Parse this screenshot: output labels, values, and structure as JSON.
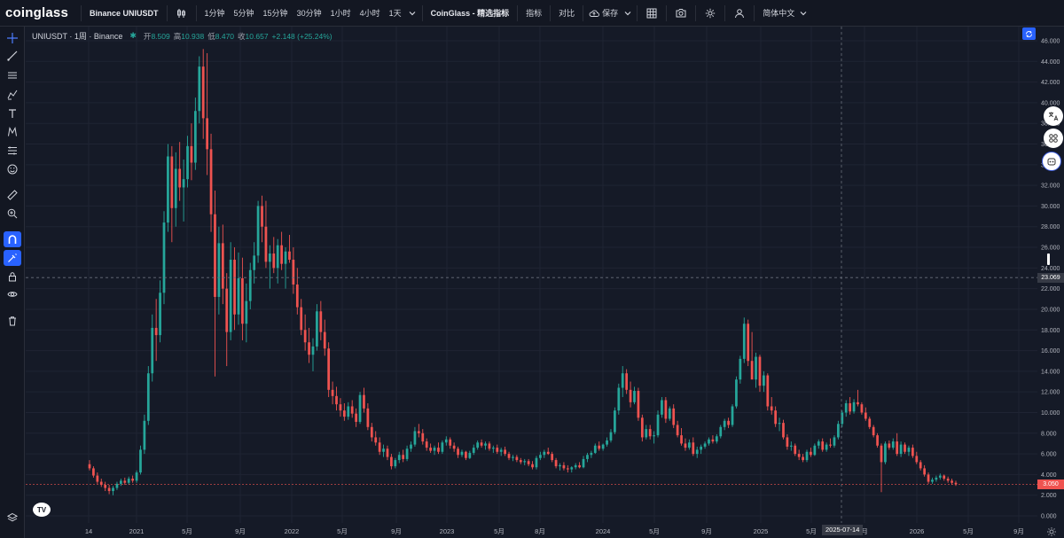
{
  "app": {
    "logo": "coinglass",
    "pair_title": "Binance UNIUSDT"
  },
  "toolbar": {
    "intervals": [
      "1分钟",
      "5分钟",
      "15分钟",
      "30分钟",
      "1小时",
      "4小时",
      "1天"
    ],
    "coinglass_label": "CoinGlass - 精选指标",
    "indicator_label": "指标",
    "compare_label": "对比",
    "save_label": "保存",
    "language_label": "简体中文"
  },
  "legend": {
    "symbol": "UNIUSDT · 1周 · Binance",
    "open_label": "开",
    "open": "8.509",
    "high_label": "高",
    "high": "10.938",
    "low_label": "低",
    "low": "8.470",
    "close_label": "收",
    "close": "10.657",
    "change": "+2.148 (+25.24%)"
  },
  "price_axis": {
    "ticks": [
      "46.000",
      "44.000",
      "42.000",
      "40.000",
      "38.000",
      "36.000",
      "34.000",
      "32.000",
      "30.000",
      "28.000",
      "26.000",
      "24.000",
      "22.000",
      "20.000",
      "18.000",
      "16.000",
      "14.000",
      "12.000",
      "10.000",
      "8.000",
      "6.000",
      "4.000",
      "2.000",
      "0.000"
    ],
    "crosshair_price": "23.069",
    "last_price": "3.050"
  },
  "time_axis": {
    "ticks": [
      "14",
      "2021",
      "5月",
      "9月",
      "2022",
      "5月",
      "9月",
      "2023",
      "5月",
      "8月",
      "2024",
      "5月",
      "9月",
      "2025",
      "5月",
      "月",
      "2026",
      "5月",
      "9月"
    ],
    "crosshair_date": "2025-07-14"
  },
  "colors": {
    "up": "#26a69a",
    "down": "#ef5350",
    "background": "#151a27",
    "grid": "#1f2433",
    "accent": "#2962ff"
  },
  "icons": [
    "crosshair-icon",
    "trend-line-icon",
    "parallel-lines-icon",
    "brush-icon",
    "text-icon",
    "pattern-icon",
    "measure-lines-icon",
    "emoji-icon",
    "ruler-icon",
    "zoom-in-icon",
    "magnet-icon",
    "lock-drawing-icon",
    "lock-icon",
    "eye-icon",
    "trash-icon",
    "layers-icon"
  ],
  "chart_data": {
    "type": "candlestick",
    "interval": "1周",
    "symbol": "UNIUSDT",
    "ylim": [
      0,
      47
    ],
    "grid": true,
    "points": [
      [
        5.0,
        5.4,
        4.4,
        4.6
      ],
      [
        4.6,
        4.8,
        3.7,
        3.9
      ],
      [
        3.9,
        4.2,
        3.1,
        3.3
      ],
      [
        3.3,
        3.6,
        2.8,
        3.0
      ],
      [
        3.0,
        3.3,
        2.4,
        2.7
      ],
      [
        2.7,
        3.0,
        2.1,
        2.4
      ],
      [
        2.4,
        2.9,
        2.0,
        2.7
      ],
      [
        2.7,
        3.3,
        2.5,
        3.1
      ],
      [
        3.1,
        3.6,
        2.9,
        3.4
      ],
      [
        3.4,
        3.7,
        3.0,
        3.2
      ],
      [
        3.2,
        3.8,
        3.0,
        3.6
      ],
      [
        3.6,
        3.9,
        3.2,
        3.4
      ],
      [
        3.4,
        4.4,
        3.2,
        4.2
      ],
      [
        4.2,
        6.8,
        4.0,
        6.4
      ],
      [
        6.4,
        9.8,
        6.0,
        9.2
      ],
      [
        9.2,
        14.5,
        8.8,
        13.8
      ],
      [
        13.8,
        19.5,
        13.0,
        18.2
      ],
      [
        18.2,
        21.0,
        15.0,
        17.5
      ],
      [
        17.5,
        22.8,
        16.8,
        21.6
      ],
      [
        21.6,
        29.5,
        20.5,
        28.4
      ],
      [
        28.4,
        36.0,
        27.5,
        34.8
      ],
      [
        34.8,
        35.8,
        26.5,
        29.8
      ],
      [
        29.8,
        35.2,
        28.0,
        33.6
      ],
      [
        33.6,
        36.2,
        30.5,
        31.8
      ],
      [
        31.8,
        34.5,
        28.5,
        32.6
      ],
      [
        32.6,
        36.8,
        31.8,
        35.8
      ],
      [
        35.8,
        38.0,
        32.5,
        34.2
      ],
      [
        34.2,
        40.5,
        33.5,
        39.2
      ],
      [
        39.2,
        44.5,
        38.0,
        43.5
      ],
      [
        43.5,
        45.2,
        36.5,
        38.5
      ],
      [
        38.5,
        44.8,
        33.0,
        35.5
      ],
      [
        35.5,
        37.0,
        27.5,
        29.2
      ],
      [
        29.2,
        31.5,
        13.5,
        21.2
      ],
      [
        21.2,
        28.0,
        19.5,
        26.4
      ],
      [
        26.4,
        28.2,
        20.5,
        22.0
      ],
      [
        22.0,
        23.5,
        14.5,
        17.8
      ],
      [
        17.8,
        26.5,
        17.0,
        24.8
      ],
      [
        24.8,
        26.0,
        18.0,
        19.5
      ],
      [
        19.5,
        25.5,
        18.5,
        23.0
      ],
      [
        23.0,
        25.0,
        17.0,
        18.6
      ],
      [
        18.6,
        22.5,
        16.8,
        20.8
      ],
      [
        20.8,
        24.5,
        20.0,
        23.8
      ],
      [
        23.8,
        26.5,
        22.5,
        25.2
      ],
      [
        25.2,
        30.5,
        24.5,
        30.0
      ],
      [
        30.0,
        31.0,
        26.5,
        28.0
      ],
      [
        28.0,
        30.5,
        24.0,
        24.6
      ],
      [
        24.6,
        26.2,
        22.0,
        25.4
      ],
      [
        25.4,
        27.0,
        23.5,
        24.0
      ],
      [
        24.0,
        26.8,
        22.5,
        26.2
      ],
      [
        26.2,
        27.5,
        23.8,
        24.4
      ],
      [
        24.4,
        26.0,
        22.0,
        25.6
      ],
      [
        25.6,
        27.2,
        24.5,
        24.8
      ],
      [
        24.8,
        26.0,
        21.5,
        22.4
      ],
      [
        22.4,
        24.0,
        19.5,
        20.2
      ],
      [
        20.2,
        21.0,
        17.5,
        18.0
      ],
      [
        18.0,
        19.5,
        16.0,
        16.8
      ],
      [
        16.8,
        18.2,
        14.8,
        15.6
      ],
      [
        15.6,
        17.2,
        14.0,
        16.4
      ],
      [
        16.4,
        20.5,
        16.0,
        19.8
      ],
      [
        19.8,
        20.8,
        17.0,
        17.8
      ],
      [
        17.8,
        19.0,
        15.5,
        16.2
      ],
      [
        16.2,
        16.8,
        11.5,
        12.2
      ],
      [
        12.2,
        13.0,
        10.8,
        11.6
      ],
      [
        11.6,
        12.5,
        10.2,
        10.8
      ],
      [
        10.8,
        11.4,
        9.6,
        10.2
      ],
      [
        10.2,
        10.9,
        9.2,
        9.6
      ],
      [
        9.6,
        11.0,
        9.3,
        10.6
      ],
      [
        10.6,
        11.2,
        9.5,
        9.9
      ],
      [
        9.9,
        10.4,
        8.6,
        9.1
      ],
      [
        9.1,
        12.0,
        8.9,
        11.7
      ],
      [
        11.7,
        12.4,
        10.0,
        10.4
      ],
      [
        10.4,
        10.9,
        8.3,
        8.6
      ],
      [
        8.6,
        9.0,
        7.2,
        7.6
      ],
      [
        7.6,
        8.2,
        6.8,
        7.1
      ],
      [
        7.1,
        7.6,
        5.9,
        6.2
      ],
      [
        6.2,
        6.9,
        5.7,
        6.5
      ],
      [
        6.5,
        6.8,
        5.4,
        5.7
      ],
      [
        5.7,
        6.0,
        4.5,
        4.8
      ],
      [
        4.8,
        5.6,
        4.6,
        5.4
      ],
      [
        5.4,
        6.2,
        5.1,
        5.9
      ],
      [
        5.9,
        6.4,
        5.2,
        5.5
      ],
      [
        5.5,
        6.8,
        5.3,
        6.5
      ],
      [
        6.5,
        7.2,
        6.2,
        6.9
      ],
      [
        6.9,
        8.6,
        6.7,
        8.2
      ],
      [
        8.2,
        8.9,
        7.6,
        8.0
      ],
      [
        8.0,
        8.4,
        6.9,
        7.2
      ],
      [
        7.2,
        7.5,
        6.3,
        6.6
      ],
      [
        6.6,
        7.0,
        6.1,
        6.3
      ],
      [
        6.3,
        6.8,
        5.9,
        6.6
      ],
      [
        6.6,
        7.1,
        6.0,
        6.2
      ],
      [
        6.2,
        7.3,
        6.0,
        7.1
      ],
      [
        7.1,
        7.7,
        6.8,
        7.4
      ],
      [
        7.4,
        7.6,
        6.5,
        6.8
      ],
      [
        6.8,
        7.1,
        6.2,
        6.5
      ],
      [
        6.5,
        6.7,
        5.6,
        5.9
      ],
      [
        5.9,
        6.4,
        5.7,
        6.2
      ],
      [
        6.2,
        6.3,
        5.4,
        5.6
      ],
      [
        5.6,
        6.3,
        5.5,
        6.1
      ],
      [
        6.1,
        6.9,
        5.9,
        6.6
      ],
      [
        6.6,
        7.3,
        6.4,
        7.1
      ],
      [
        7.1,
        7.4,
        6.6,
        6.8
      ],
      [
        6.8,
        7.2,
        6.4,
        7.0
      ],
      [
        7.0,
        7.2,
        6.3,
        6.5
      ],
      [
        6.5,
        6.8,
        6.1,
        6.6
      ],
      [
        6.6,
        6.9,
        6.0,
        6.2
      ],
      [
        6.2,
        6.6,
        5.8,
        6.4
      ],
      [
        6.4,
        6.7,
        5.8,
        6.0
      ],
      [
        6.0,
        6.2,
        5.4,
        5.6
      ],
      [
        5.6,
        5.9,
        5.3,
        5.7
      ],
      [
        5.7,
        5.9,
        5.2,
        5.4
      ],
      [
        5.4,
        5.6,
        5.0,
        5.2
      ],
      [
        5.2,
        5.5,
        4.9,
        5.3
      ],
      [
        5.3,
        5.5,
        4.8,
        5.0
      ],
      [
        5.0,
        5.3,
        4.5,
        4.7
      ],
      [
        4.7,
        5.8,
        4.5,
        5.6
      ],
      [
        5.6,
        6.2,
        5.4,
        5.9
      ],
      [
        5.9,
        6.4,
        5.6,
        6.2
      ],
      [
        6.2,
        6.6,
        5.9,
        6.0
      ],
      [
        6.0,
        6.2,
        5.2,
        5.4
      ],
      [
        5.4,
        5.6,
        4.6,
        4.8
      ],
      [
        4.8,
        5.1,
        4.4,
        4.9
      ],
      [
        4.9,
        5.2,
        4.4,
        4.6
      ],
      [
        4.6,
        4.9,
        4.2,
        4.5
      ],
      [
        4.5,
        4.8,
        4.2,
        4.7
      ],
      [
        4.7,
        5.1,
        4.5,
        4.9
      ],
      [
        4.9,
        5.2,
        4.6,
        4.7
      ],
      [
        4.7,
        5.8,
        4.6,
        5.5
      ],
      [
        5.5,
        6.1,
        5.2,
        5.9
      ],
      [
        5.9,
        6.3,
        5.6,
        6.1
      ],
      [
        6.1,
        7.0,
        6.0,
        6.8
      ],
      [
        6.8,
        7.2,
        6.3,
        6.5
      ],
      [
        6.5,
        7.0,
        6.3,
        6.9
      ],
      [
        6.9,
        7.6,
        6.7,
        7.3
      ],
      [
        7.3,
        8.4,
        7.1,
        8.1
      ],
      [
        8.1,
        10.5,
        7.9,
        10.2
      ],
      [
        10.2,
        12.8,
        9.8,
        12.4
      ],
      [
        12.4,
        14.5,
        11.5,
        13.8
      ],
      [
        13.8,
        14.2,
        11.8,
        12.2
      ],
      [
        12.2,
        13.0,
        10.5,
        11.0
      ],
      [
        11.0,
        12.5,
        10.8,
        12.1
      ],
      [
        12.1,
        12.4,
        9.2,
        9.5
      ],
      [
        9.5,
        9.8,
        7.2,
        7.6
      ],
      [
        7.6,
        8.8,
        7.4,
        8.4
      ],
      [
        8.4,
        8.8,
        7.4,
        7.7
      ],
      [
        7.7,
        8.2,
        7.0,
        7.8
      ],
      [
        7.8,
        10.2,
        7.6,
        9.8
      ],
      [
        9.8,
        11.5,
        9.5,
        11.2
      ],
      [
        11.2,
        11.5,
        9.0,
        9.4
      ],
      [
        9.4,
        10.6,
        9.2,
        10.4
      ],
      [
        10.4,
        10.8,
        8.5,
        8.8
      ],
      [
        8.8,
        9.2,
        7.6,
        7.8
      ],
      [
        7.8,
        8.5,
        6.8,
        7.0
      ],
      [
        7.0,
        7.5,
        6.3,
        6.6
      ],
      [
        6.6,
        7.4,
        6.4,
        7.1
      ],
      [
        7.1,
        7.6,
        5.8,
        6.0
      ],
      [
        6.0,
        6.7,
        5.6,
        6.4
      ],
      [
        6.4,
        6.9,
        6.0,
        6.7
      ],
      [
        6.7,
        7.2,
        6.5,
        7.0
      ],
      [
        7.0,
        7.6,
        6.8,
        7.4
      ],
      [
        7.4,
        7.8,
        7.0,
        7.2
      ],
      [
        7.2,
        7.9,
        7.0,
        7.7
      ],
      [
        7.7,
        8.8,
        7.5,
        8.6
      ],
      [
        8.6,
        9.4,
        8.3,
        9.2
      ],
      [
        9.2,
        9.5,
        8.5,
        8.8
      ],
      [
        8.8,
        10.8,
        8.6,
        10.6
      ],
      [
        10.6,
        13.5,
        10.4,
        13.2
      ],
      [
        13.2,
        15.5,
        12.8,
        15.2
      ],
      [
        15.2,
        19.2,
        14.8,
        18.6
      ],
      [
        18.6,
        19.0,
        14.5,
        15.0
      ],
      [
        15.0,
        17.8,
        14.0,
        13.2
      ],
      [
        13.2,
        15.8,
        12.4,
        15.4
      ],
      [
        15.4,
        15.6,
        12.0,
        12.6
      ],
      [
        12.6,
        14.0,
        12.0,
        13.6
      ],
      [
        13.6,
        13.8,
        10.2,
        10.6
      ],
      [
        10.6,
        11.5,
        9.8,
        10.2
      ],
      [
        10.2,
        10.6,
        8.6,
        8.9
      ],
      [
        8.9,
        9.5,
        8.2,
        9.0
      ],
      [
        9.0,
        9.3,
        7.4,
        7.6
      ],
      [
        7.6,
        7.9,
        6.4,
        6.7
      ],
      [
        6.7,
        7.2,
        6.3,
        6.8
      ],
      [
        6.8,
        7.0,
        5.8,
        6.0
      ],
      [
        6.0,
        6.4,
        5.4,
        5.7
      ],
      [
        5.7,
        6.0,
        5.2,
        5.4
      ],
      [
        5.4,
        6.4,
        5.2,
        6.2
      ],
      [
        6.2,
        6.6,
        5.7,
        5.9
      ],
      [
        5.9,
        7.0,
        5.8,
        6.8
      ],
      [
        6.8,
        7.4,
        6.5,
        7.2
      ],
      [
        7.2,
        7.5,
        6.2,
        6.4
      ],
      [
        6.4,
        7.1,
        6.2,
        6.9
      ],
      [
        6.9,
        7.5,
        6.6,
        6.8
      ],
      [
        6.8,
        7.8,
        6.6,
        7.6
      ],
      [
        7.6,
        9.2,
        7.4,
        8.9
      ],
      [
        8.9,
        10.2,
        8.6,
        10.0
      ],
      [
        10.0,
        11.2,
        9.6,
        10.9
      ],
      [
        10.9,
        11.5,
        9.8,
        10.1
      ],
      [
        10.1,
        11.3,
        9.9,
        11.0
      ],
      [
        11.0,
        12.2,
        10.6,
        10.8
      ],
      [
        10.8,
        11.0,
        9.8,
        10.0
      ],
      [
        10.0,
        10.5,
        9.2,
        9.4
      ],
      [
        9.4,
        9.6,
        8.4,
        8.6
      ],
      [
        8.6,
        8.8,
        7.6,
        7.8
      ],
      [
        7.8,
        8.0,
        6.6,
        6.8
      ],
      [
        6.8,
        7.0,
        2.3,
        5.2
      ],
      [
        5.2,
        7.2,
        5.0,
        7.0
      ],
      [
        7.0,
        7.3,
        6.4,
        6.6
      ],
      [
        6.6,
        7.5,
        6.4,
        7.2
      ],
      [
        7.2,
        8.0,
        5.8,
        6.0
      ],
      [
        6.0,
        7.2,
        5.7,
        6.9
      ],
      [
        6.9,
        7.1,
        6.0,
        6.2
      ],
      [
        6.2,
        6.8,
        5.8,
        6.6
      ],
      [
        6.6,
        6.9,
        5.6,
        5.8
      ],
      [
        5.8,
        6.2,
        5.0,
        5.2
      ],
      [
        5.2,
        5.4,
        4.4,
        4.6
      ],
      [
        4.6,
        4.9,
        3.8,
        4.0
      ],
      [
        4.0,
        4.2,
        3.1,
        3.3
      ],
      [
        3.3,
        3.7,
        3.1,
        3.5
      ],
      [
        3.5,
        3.9,
        3.3,
        3.7
      ],
      [
        3.7,
        4.1,
        3.5,
        3.9
      ],
      [
        3.9,
        4.0,
        3.4,
        3.6
      ],
      [
        3.6,
        3.8,
        3.2,
        3.4
      ],
      [
        3.4,
        3.6,
        3.0,
        3.2
      ],
      [
        3.2,
        3.4,
        2.9,
        3.05
      ]
    ]
  }
}
